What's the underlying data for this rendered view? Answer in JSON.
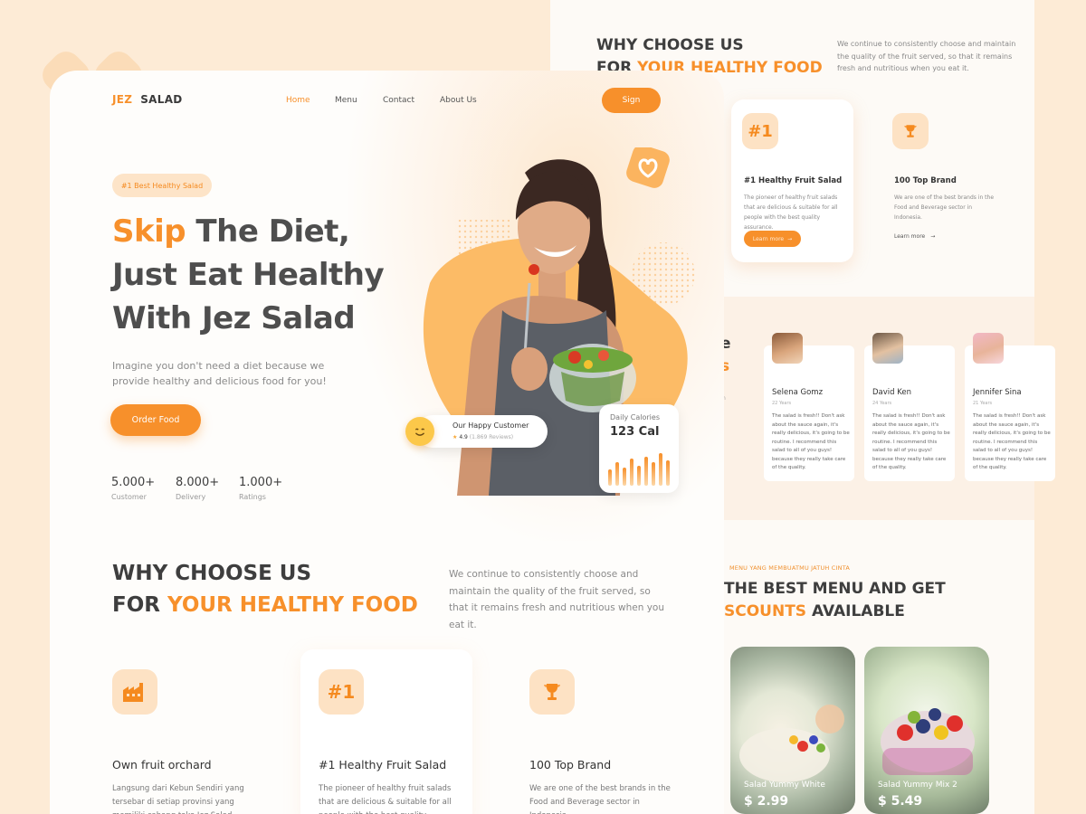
{
  "brand": {
    "part1": "JEZ",
    "part2": "SALAD"
  },
  "nav": {
    "items": [
      "Home",
      "Menu",
      "Contact",
      "About Us"
    ],
    "active": "Home",
    "sign_label": "Sign"
  },
  "hero": {
    "badge": "#1 Best Healthy Salad",
    "title_accent": "Skip",
    "title_line1": " The Diet,",
    "title_line2": "Just Eat Healthy",
    "title_line3": "With Jez Salad",
    "subtitle": "Imagine you don't need a diet because we provide healthy and delicious food for you!",
    "cta": "Order Food",
    "stats": [
      {
        "value": "5.000+",
        "label": "Customer"
      },
      {
        "value": "8.000+",
        "label": "Delivery"
      },
      {
        "value": "1.000+",
        "label": "Ratings"
      }
    ]
  },
  "happy_customer": {
    "title": "Our Happy Customer",
    "rating": "4.9",
    "reviews": "(1.869 Reviews)"
  },
  "calories": {
    "label": "Daily Calories",
    "value": "123 Cal"
  },
  "why": {
    "line1": "WHY CHOOSE US",
    "line2_prefix": "FOR ",
    "line2_accent": "YOUR HEALTHY FOOD",
    "description": "We continue to consistently choose and maintain the quality of the fruit served, so that it remains fresh and nutritious when you eat it.",
    "features": [
      {
        "title": "Own fruit orchard",
        "desc": "Langsung dari Kebun Sendiri yang tersebar di setiap provinsi yang memiliki cabang toko Jez Salad",
        "icon": "factory-icon"
      },
      {
        "title": "#1 Healthy Fruit Salad",
        "desc": "The pioneer of healthy fruit salads that are delicious & suitable for all people with the best quality assurance.",
        "icon": "number-one-icon"
      },
      {
        "title": "100 Top Brand",
        "desc": "We are one of the best brands in the Food and Beverage sector in Indonesia.",
        "icon": "trophy-icon"
      }
    ],
    "learn_more": "Learn more"
  },
  "testimonials": {
    "fragment_1": "e",
    "fragment_2": "s",
    "fragment_3": "m",
    "items": [
      {
        "name": "Selena Gomz",
        "age": "22 Years",
        "text": "The salad is fresh!! Don't ask about the sauce again, it's really delicious, it's going to be routine. I recommend this salad to all of you guys! because they really take care of the quality."
      },
      {
        "name": "David Ken",
        "age": "24 Years",
        "text": "The salad is fresh!! Don't ask about the sauce again, it's really delicious, it's going to be routine. I recommend this salad to all of you guys! because they really take care of the quality."
      },
      {
        "name": "Jennifer Sina",
        "age": "21 Years",
        "text": "The salad is fresh!! Don't ask about the sauce again, it's really delicious, it's going to be routine. I recommend this salad to all of you guys! because they really take care of the quality."
      }
    ]
  },
  "menu": {
    "tag": "MENU YANG MEMBUATMU JATUH CINTA",
    "line1": "THE BEST MENU AND GET",
    "line2_accent": "SCOUNTS",
    "line2_rest": " AVAILABLE",
    "items": [
      {
        "name": "Salad Yummy White",
        "price": "$ 2.99"
      },
      {
        "name": "Salad Yummy Mix 2",
        "price": "$ 5.49"
      }
    ]
  },
  "colors": {
    "accent": "#f7902b",
    "accent_light": "#fde2c4",
    "page_bg": "#fdebd6"
  }
}
